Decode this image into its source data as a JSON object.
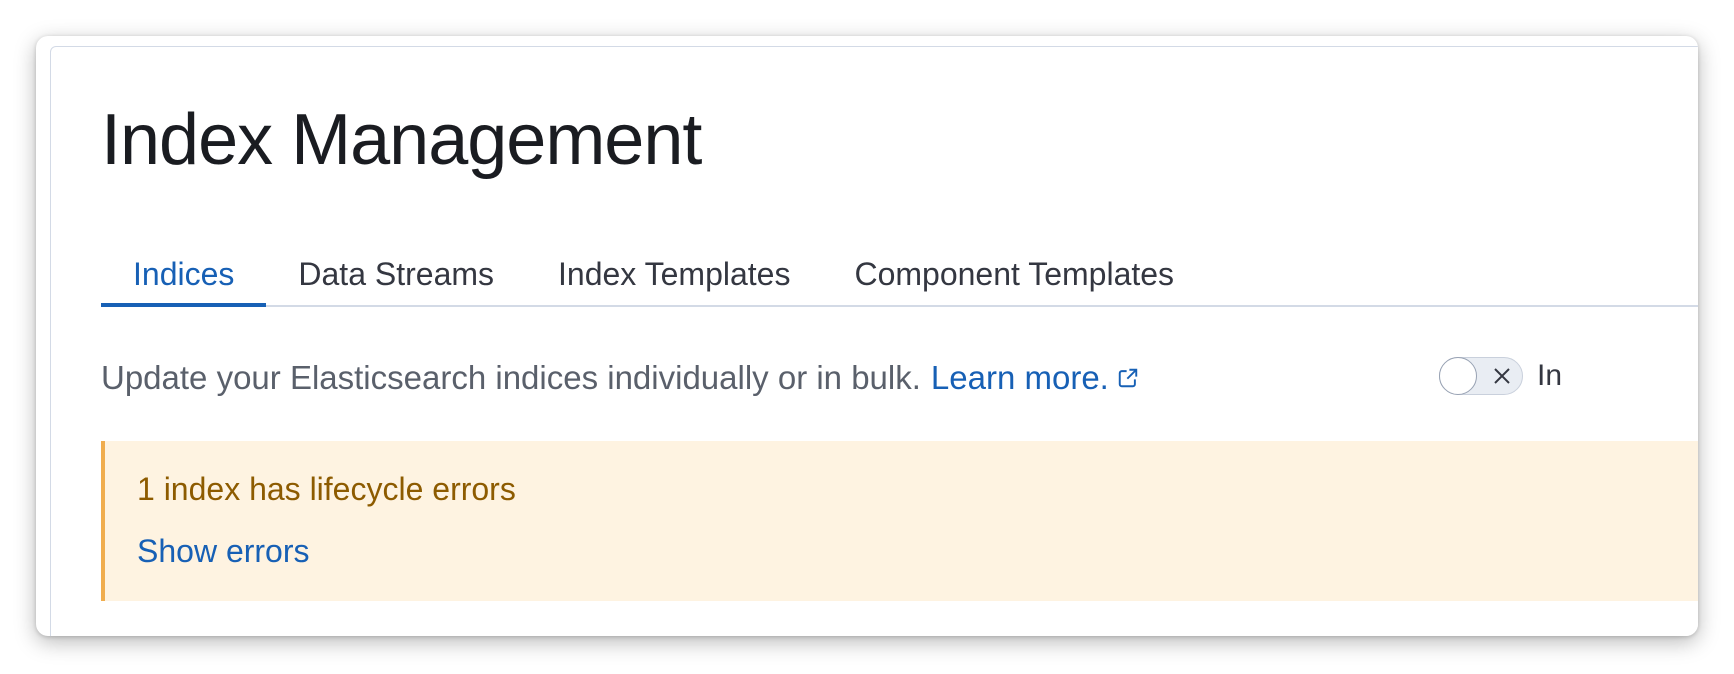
{
  "page": {
    "title": "Index Management"
  },
  "tabs": [
    {
      "label": "Indices",
      "selected": true
    },
    {
      "label": "Data Streams",
      "selected": false
    },
    {
      "label": "Index Templates",
      "selected": false
    },
    {
      "label": "Component Templates",
      "selected": false
    }
  ],
  "description": {
    "text": "Update your Elasticsearch indices individually or in bulk.",
    "link_label": "Learn more.",
    "link_icon": "external-link-icon"
  },
  "toggle": {
    "checked": false,
    "label_visible": "In",
    "off_icon": "close-icon"
  },
  "callout": {
    "title": "1 index has lifecycle errors",
    "action_label": "Show errors"
  },
  "colors": {
    "accent": "#1760b5",
    "title_text": "#1a1c21",
    "body_text": "#5a606b",
    "warning_bg": "#fef3e1",
    "warning_border": "#f0ad4e",
    "warning_text": "#8d5b00",
    "border": "#d3dae6"
  }
}
